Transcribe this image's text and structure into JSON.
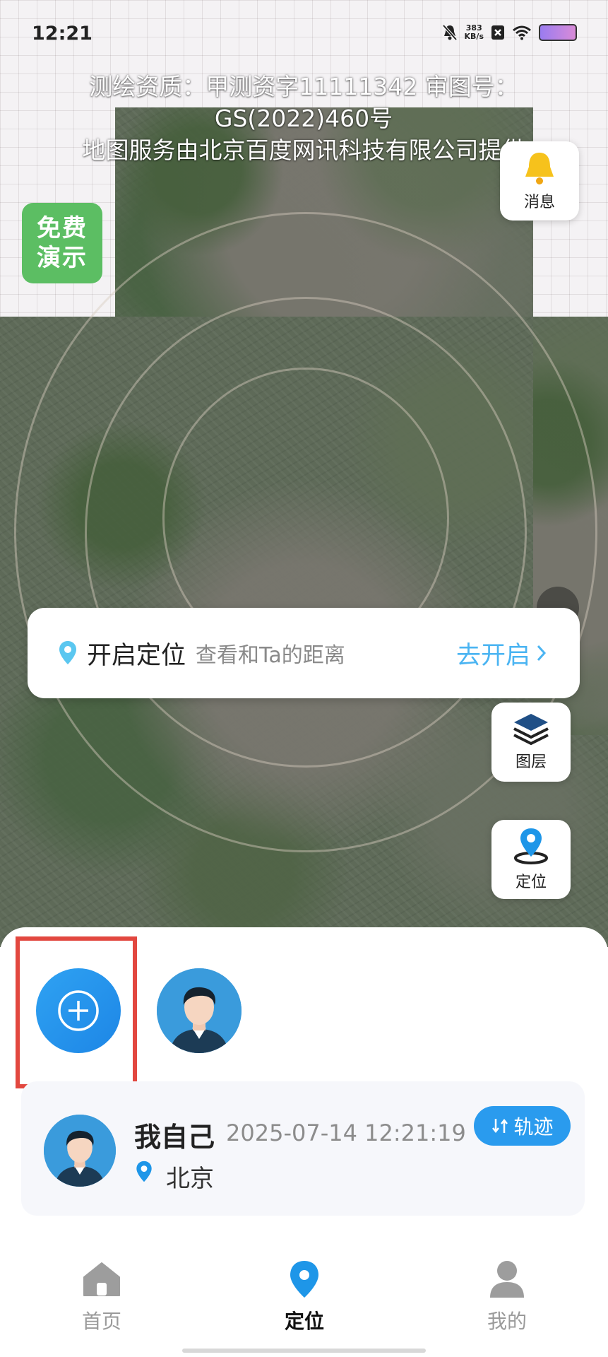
{
  "status_bar": {
    "time": "12:21",
    "net_speed_value": "383",
    "net_speed_unit": "KB/s"
  },
  "map": {
    "notice_line1": "测绘资质：甲测资字11111342  审图号：",
    "notice_line2": "GS(2022)460号",
    "notice_line3": "地图服务由北京百度网讯科技有限公司提供",
    "free_demo_line1": "免费",
    "free_demo_line2": "演示"
  },
  "controls": {
    "messages_label": "消息",
    "layers_label": "图层",
    "locate_label": "定位"
  },
  "location_prompt": {
    "title": "开启定位",
    "subtitle": "查看和Ta的距离",
    "action": "去开启"
  },
  "member_card": {
    "name": "我自己",
    "time": "2025-07-14 12:21:19",
    "city": "北京",
    "track_label": "轨迹"
  },
  "tabs": [
    {
      "label": "首页",
      "icon": "home-icon"
    },
    {
      "label": "定位",
      "icon": "location-pin-icon"
    },
    {
      "label": "我的",
      "icon": "person-icon"
    }
  ],
  "colors": {
    "accent": "#2a9bee",
    "demo_green": "#5cbe63",
    "highlight_red": "#e2473f"
  }
}
